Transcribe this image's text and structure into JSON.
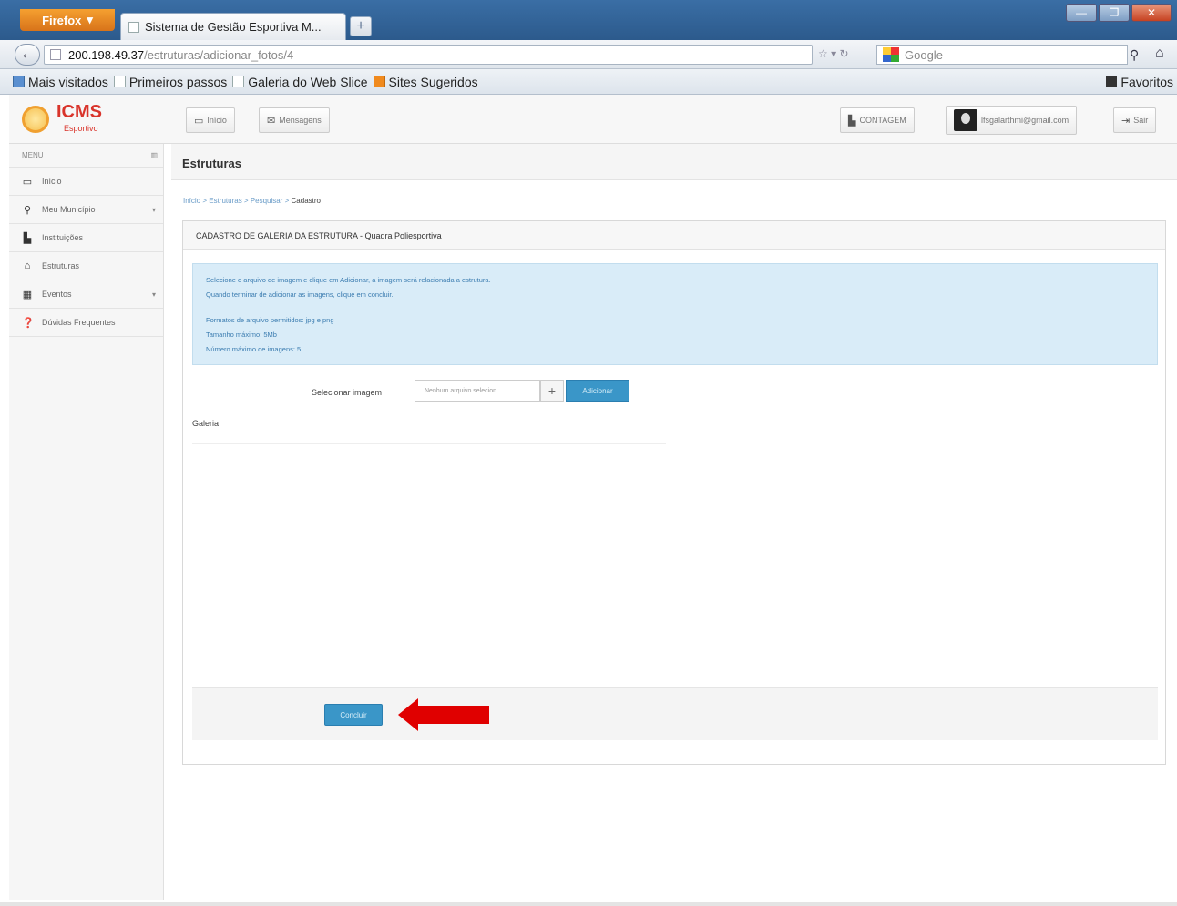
{
  "browser": {
    "app_button": "Firefox",
    "tab_title": "Sistema de Gestão Esportiva M...",
    "url_host": "200.198.49.37",
    "url_path": "/estruturas/adicionar_fotos/4",
    "search_placeholder": "Google",
    "bookmarks": [
      "Mais visitados",
      "Primeiros passos",
      "Galeria do Web Slice",
      "Sites Sugeridos"
    ],
    "favorites_label": "Favoritos"
  },
  "header": {
    "logo_title": "ICMS",
    "logo_subtitle": "Esportivo",
    "inicio": "Início",
    "mensagens": "Mensagens",
    "contagem": "CONTAGEM",
    "user_email": "lfsgalarthmi@gmail.com",
    "sair": "Sair"
  },
  "sidebar": {
    "title": "MENU",
    "items": [
      {
        "label": "Início",
        "icon": "monitor-icon"
      },
      {
        "label": "Meu Município",
        "icon": "map-marker-icon"
      },
      {
        "label": "Instituições",
        "icon": "building-icon"
      },
      {
        "label": "Estruturas",
        "icon": "home-icon"
      },
      {
        "label": "Eventos",
        "icon": "calendar-icon"
      },
      {
        "label": "Dúvidas Frequentes",
        "icon": "question-icon"
      }
    ]
  },
  "page": {
    "title": "Estruturas",
    "breadcrumb": {
      "links": "Início > Estruturas > Pesquisar > ",
      "current": "Cadastro"
    },
    "panel_title": "CADASTRO DE GALERIA DA ESTRUTURA - Quadra Poliesportiva",
    "info": {
      "line1": "Selecione o arquivo de imagem e clique em Adicionar, a imagem será relacionada a estrutura.",
      "line2": "Quando terminar de adicionar as imagens, clique em concluir.",
      "line3": "Formatos de arquivo permitidos: jpg e png",
      "line4": "Tamanho máximo: 5Mb",
      "line5": "Número máximo de imagens: 5"
    },
    "select_label": "Selecionar imagem",
    "file_placeholder": "Nenhum arquivo selecion...",
    "add_button": "Adicionar",
    "gallery_label": "Galeria",
    "finish_button": "Concluir"
  },
  "colors": {
    "accent": "#3a96c8",
    "logo": "#d9342b",
    "annotation_arrow": "#e00000"
  }
}
